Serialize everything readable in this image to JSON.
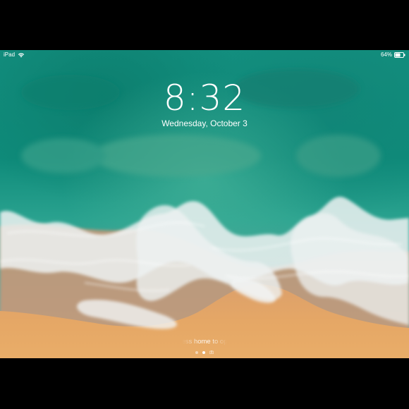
{
  "status_bar": {
    "device_label": "iPad",
    "battery_text": "64%",
    "battery_level": 0.64
  },
  "lock_screen": {
    "time": "8:32",
    "date": "Wednesday, October 3",
    "unlock_hint": "ess home to op"
  },
  "pages": {
    "count": 3,
    "active_index": 1
  },
  "icons": [
    "wifi-icon",
    "battery-icon",
    "camera-page-icon"
  ],
  "colors": {
    "sea_deep": "#0b8a7a",
    "sea_shallow": "#1fae9d",
    "foam": "#e9eef0",
    "sand": "#e3a466"
  }
}
